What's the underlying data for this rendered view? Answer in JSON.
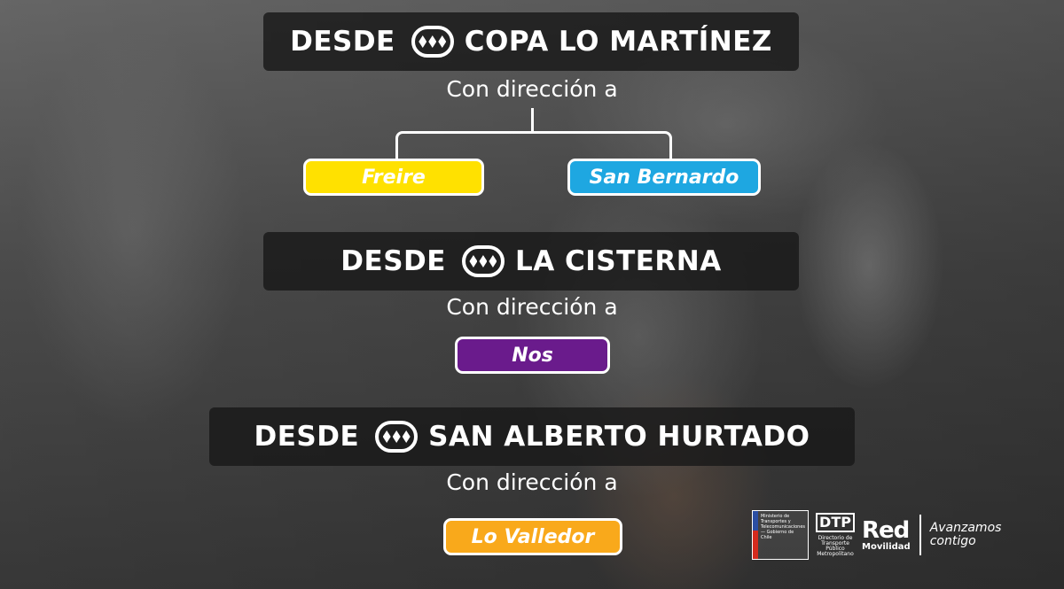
{
  "sections": [
    {
      "desde": "DESDE",
      "station": "COPA LO MARTÍNEZ",
      "direction_label": "Con dirección a",
      "destinations": [
        {
          "name": "Freire",
          "color": "#ffe100"
        },
        {
          "name": "San Bernardo",
          "color": "#1ea7e1"
        }
      ]
    },
    {
      "desde": "DESDE",
      "station": "LA CISTERNA",
      "direction_label": "Con dirección a",
      "destinations": [
        {
          "name": "Nos",
          "color": "#6a1b8c"
        }
      ]
    },
    {
      "desde": "DESDE",
      "station": "SAN ALBERTO HURTADO",
      "direction_label": "Con dirección a",
      "destinations": [
        {
          "name": "Lo Valledor",
          "color": "#f9a91b"
        }
      ]
    }
  ],
  "logos": {
    "gobierno": "Ministerio de Transportes y Telecomunicaciones — Gobierno de Chile",
    "dtp": "DTP",
    "dtp_sub": "Directorio de Transporte Público Metropolitano",
    "red": "Red",
    "red_sub": "Movilidad",
    "tagline_1": "Avanzamos",
    "tagline_2": "contigo"
  }
}
